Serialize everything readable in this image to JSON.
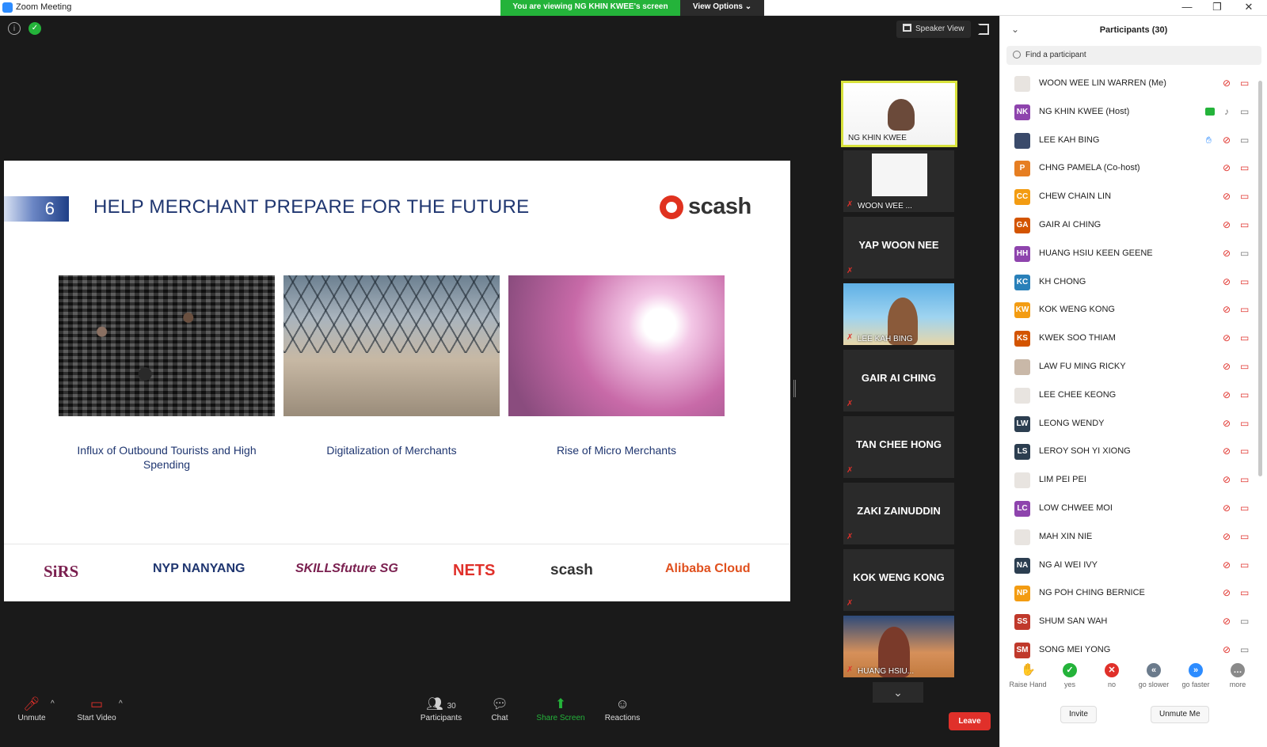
{
  "window": {
    "title": "Zoom Meeting",
    "minimize": "—",
    "maximize": "❐",
    "close": "✕"
  },
  "share_banner": {
    "viewing": "You are viewing NG KHIN KWEE's screen",
    "view_options": "View Options ⌄"
  },
  "top_controls": {
    "speaker_view": "Speaker View"
  },
  "slide": {
    "number": "6",
    "title": "HELP MERCHANT PREPARE FOR THE FUTURE",
    "brand": "scash",
    "captions": [
      "Influx of Outbound Tourists and High Spending",
      "Digitalization of Merchants",
      "Rise of Micro Merchants"
    ],
    "logos": [
      "SiRS",
      "NYP NANYANG",
      "SKILLSfuture SG",
      "NETS",
      "scash",
      "Alibaba Cloud"
    ],
    "colors": {
      "title": "#1f3670",
      "accent": "#e0321f"
    }
  },
  "gallery": [
    {
      "label": "NG KHIN KWEE",
      "type": "video"
    },
    {
      "label": "WOON WEE ...",
      "type": "video"
    },
    {
      "label": "YAP WOON NEE",
      "type": "name"
    },
    {
      "label": "LEE KAH BING",
      "type": "video"
    },
    {
      "label": "GAIR AI CHING",
      "type": "name"
    },
    {
      "label": "TAN CHEE HONG",
      "type": "name"
    },
    {
      "label": "ZAKI ZAINUDDIN",
      "type": "name"
    },
    {
      "label": "KOK WENG KONG",
      "type": "name"
    },
    {
      "label": "HUANG HSIU...",
      "type": "video"
    }
  ],
  "toolbar": {
    "unmute": "Unmute",
    "start_video": "Start Video",
    "participants": "Participants",
    "participants_count": "30",
    "chat": "Chat",
    "share_screen": "Share Screen",
    "reactions": "Reactions",
    "leave": "Leave"
  },
  "panel": {
    "title": "Participants (30)",
    "search_placeholder": "Find a participant",
    "participants": [
      {
        "initials": "",
        "name": "WOON WEE LIN WARREN (Me)",
        "color": "#e8e4e0"
      },
      {
        "initials": "NK",
        "name": "NG KHIN KWEE (Host)",
        "color": "#8e44ad"
      },
      {
        "initials": "",
        "name": "LEE KAH BING",
        "color": "#3a4a6a"
      },
      {
        "initials": "P",
        "name": "CHNG PAMELA (Co-host)",
        "color": "#e67e22"
      },
      {
        "initials": "CC",
        "name": "CHEW CHAIN LIN",
        "color": "#f39c12"
      },
      {
        "initials": "GA",
        "name": "GAIR AI CHING",
        "color": "#d35400"
      },
      {
        "initials": "HH",
        "name": "HUANG HSIU KEEN GEENE",
        "color": "#8e44ad"
      },
      {
        "initials": "KC",
        "name": "KH CHONG",
        "color": "#2980b9"
      },
      {
        "initials": "KW",
        "name": "KOK WENG KONG",
        "color": "#f39c12"
      },
      {
        "initials": "KS",
        "name": "KWEK SOO THIAM",
        "color": "#d35400"
      },
      {
        "initials": "",
        "name": "LAW FU MING RICKY",
        "color": "#c9b8a8"
      },
      {
        "initials": "",
        "name": "LEE CHEE KEONG",
        "color": "#e8e4e0"
      },
      {
        "initials": "LW",
        "name": "LEONG WENDY",
        "color": "#2c3e50"
      },
      {
        "initials": "LS",
        "name": "LEROY SOH YI XIONG",
        "color": "#2c3e50"
      },
      {
        "initials": "",
        "name": "LIM PEI PEI",
        "color": "#e8e4e0"
      },
      {
        "initials": "LC",
        "name": "LOW CHWEE MOI",
        "color": "#8e44ad"
      },
      {
        "initials": "",
        "name": "MAH XIN NIE",
        "color": "#e8e4e0"
      },
      {
        "initials": "NA",
        "name": "NG AI WEI IVY",
        "color": "#2c3e50"
      },
      {
        "initials": "NP",
        "name": "NG POH CHING BERNICE",
        "color": "#f39c12"
      },
      {
        "initials": "SS",
        "name": "SHUM SAN WAH",
        "color": "#c0392b"
      },
      {
        "initials": "SM",
        "name": "SONG MEI YONG",
        "color": "#c0392b"
      }
    ],
    "reactions": [
      {
        "label": "Raise Hand",
        "glyph": "✋",
        "color": "#2d8cff"
      },
      {
        "label": "yes",
        "glyph": "✓",
        "color": "#24b33a"
      },
      {
        "label": "no",
        "glyph": "✕",
        "color": "#e0302a"
      },
      {
        "label": "go slower",
        "glyph": "«",
        "color": "#6b7b8c"
      },
      {
        "label": "go faster",
        "glyph": "»",
        "color": "#2d8cff"
      },
      {
        "label": "more",
        "glyph": "…",
        "color": "#8a8a8a"
      }
    ],
    "invite": "Invite",
    "unmute_me": "Unmute Me"
  }
}
